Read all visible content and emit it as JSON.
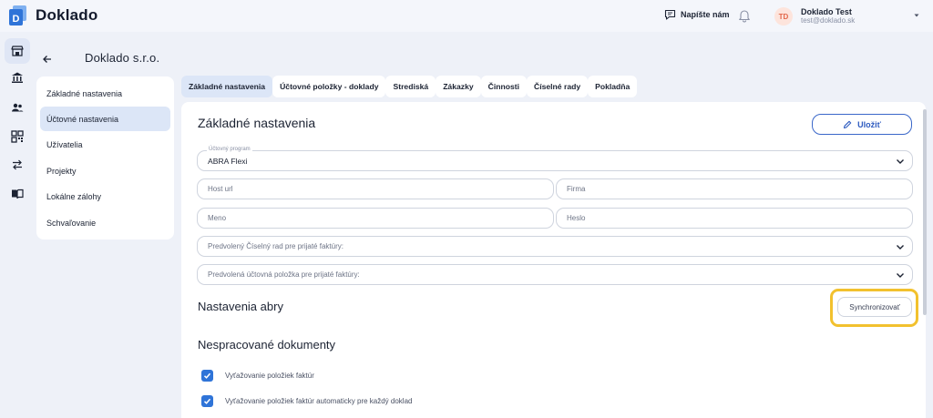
{
  "app": {
    "name": "Doklado",
    "brand_color": "#2f74d8"
  },
  "topbar": {
    "contact_label": "Napíšte nám",
    "user": {
      "initials": "TD",
      "name": "Doklado Test",
      "email": "test@doklado.sk"
    }
  },
  "rail": {
    "icons": [
      "store-icon",
      "bank-icon",
      "users-icon",
      "qr-code-icon",
      "transfer-icon",
      "book-icon"
    ],
    "active_index": 0
  },
  "header": {
    "company": "Doklado s.r.o."
  },
  "menu": {
    "items": [
      {
        "label": "Základné nastavenia"
      },
      {
        "label": "Účtovné nastavenia"
      },
      {
        "label": "Užívatelia"
      },
      {
        "label": "Projekty"
      },
      {
        "label": "Lokálne zálohy"
      },
      {
        "label": "Schvaľovanie"
      }
    ],
    "active_index": 1
  },
  "tabs": {
    "items": [
      {
        "label": "Základné nastavenia"
      },
      {
        "label": "Účtovné položky - doklady"
      },
      {
        "label": "Strediská"
      },
      {
        "label": "Zákazky"
      },
      {
        "label": "Činnosti"
      },
      {
        "label": "Číselné rady"
      },
      {
        "label": "Pokladňa"
      }
    ],
    "active_index": 0
  },
  "main": {
    "title": "Základné nastavenia",
    "save_label": "Uložiť",
    "program": {
      "label": "Účtovný program",
      "value": "ABRA Flexi"
    },
    "host_placeholder": "Host url",
    "firma_placeholder": "Firma",
    "meno_placeholder": "Meno",
    "heslo_placeholder": "Heslo",
    "ciselny_rad_placeholder": "Predvolený Číselný rad pre prijaté faktúry:",
    "uctovna_polozka_placeholder": "Predvolená účtovná položka pre prijaté faktúry:",
    "abra_section": "Nastavenia abry",
    "sync_label": "Synchronizovať",
    "unprocessed_section": "Nespracované dokumenty",
    "checks": [
      {
        "label": "Vyťažovanie položiek faktúr",
        "checked": true
      },
      {
        "label": "Vyťažovanie položiek faktúr automaticky pre každý doklad",
        "checked": true
      }
    ]
  },
  "colors": {
    "highlight": "#f2c12e",
    "active_bg": "#dce6f7"
  }
}
